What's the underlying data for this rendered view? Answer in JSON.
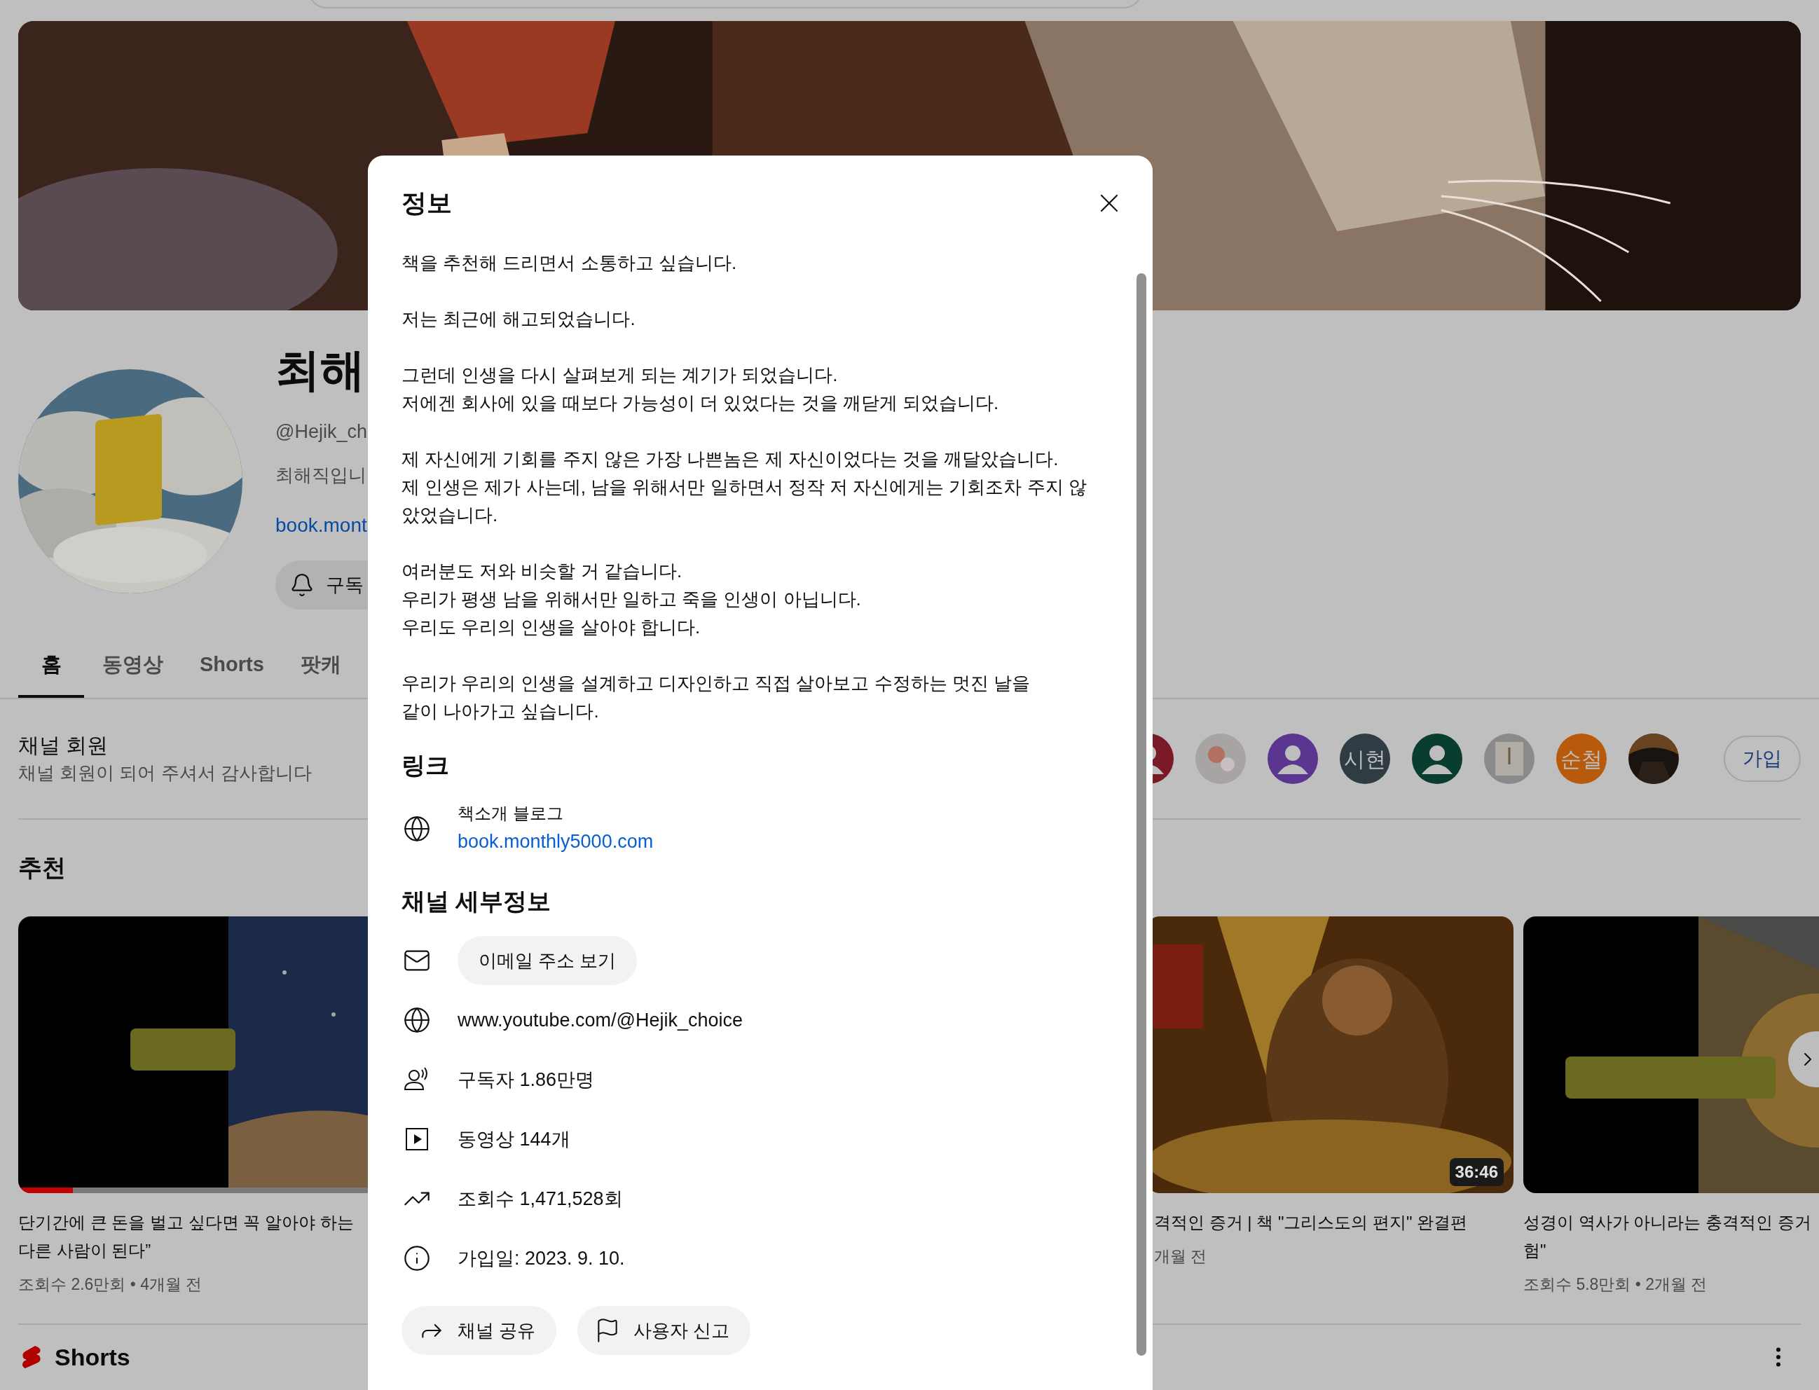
{
  "channel": {
    "name": "최해",
    "handle": "@Hejik_ch",
    "description": "최해직입니",
    "link": "book.mont",
    "subscribe_button": "구독"
  },
  "tabs": [
    {
      "label": "홈",
      "selected": true
    },
    {
      "label": "동영상",
      "selected": false
    },
    {
      "label": "Shorts",
      "selected": false
    },
    {
      "label": "팟캐",
      "selected": false
    }
  ],
  "membership": {
    "title": "채널 회원",
    "subtitle": "채널 회원이 되어 주셔서 감사합니다",
    "join_button": "가입",
    "members": [
      {
        "kind": "person",
        "color": "#7a1a26"
      },
      {
        "kind": "picture"
      },
      {
        "kind": "person",
        "color": "#5a3690"
      },
      {
        "kind": "initials",
        "text": "시현",
        "color": "#2f3c43"
      },
      {
        "kind": "person",
        "color": "#093d30"
      },
      {
        "kind": "picture"
      },
      {
        "kind": "initials",
        "text": "순철",
        "color": "#b85a0c"
      },
      {
        "kind": "picture"
      }
    ]
  },
  "recommended": {
    "title": "추천",
    "videos": [
      {
        "title_lines": [
          "단기간에 큰 돈을 벌고 싶다면 꼭 알아야 하는",
          "다른 사람이 된다”"
        ],
        "meta": "조회수 2.6만회 • 4개월 전",
        "level": 0.15
      },
      {
        "title_lines": [
          "격적인 증거 | 책 \"그리스도의 편지\" 완결편"
        ],
        "meta": "개월 전",
        "duration": "36:46"
      },
      {
        "title_lines": [
          "성경이 역사가 아니라는 충격적인 증거",
          "험\""
        ],
        "meta": "조회수 5.8만회 • 2개월 전"
      }
    ]
  },
  "shorts": {
    "title": "Shorts"
  },
  "dialog": {
    "title": "정보",
    "description": "책을 추천해 드리면서 소통하고 싶습니다.\n\n저는 최근에 해고되었습니다.\n\n그런데 인생을 다시 살펴보게 되는 계기가 되었습니다.\n저에겐 회사에 있을 때보다 가능성이 더 있었다는 것을 깨닫게 되었습니다.\n\n제 자신에게 기회를 주지 않은 가장 나쁜놈은 제 자신이었다는 것을 깨달았습니다.\n제 인생은 제가 사는데, 남을 위해서만 일하면서 정작 저 자신에게는 기회조차 주지 않았었습니다.\n\n여러분도 저와 비슷할 거 같습니다.\n우리가 평생 남을 위해서만 일하고 죽을 인생이 아닙니다.\n우리도 우리의 인생을 살아야 합니다.\n\n우리가 우리의 인생을 설계하고 디자인하고 직접 살아보고 수정하는 멋진 날을\n같이 나아가고 싶습니다.",
    "links_heading": "링크",
    "links": [
      {
        "title": "책소개 블로그",
        "url": "book.monthly5000.com"
      }
    ],
    "details_heading": "채널 세부정보",
    "details": [
      {
        "kind": "email",
        "button": "이메일 주소 보기"
      },
      {
        "kind": "website",
        "text": "www.youtube.com/@Hejik_choice"
      },
      {
        "kind": "subscribers",
        "text": "구독자 1.86만명"
      },
      {
        "kind": "videos",
        "text": "동영상 144개"
      },
      {
        "kind": "views",
        "text": "조회수 1,471,528회"
      },
      {
        "kind": "joined",
        "text": "가입일: 2023. 9. 10."
      }
    ],
    "actions": [
      {
        "kind": "share",
        "label": "채널 공유"
      },
      {
        "kind": "report",
        "label": "사용자 신고"
      }
    ]
  }
}
